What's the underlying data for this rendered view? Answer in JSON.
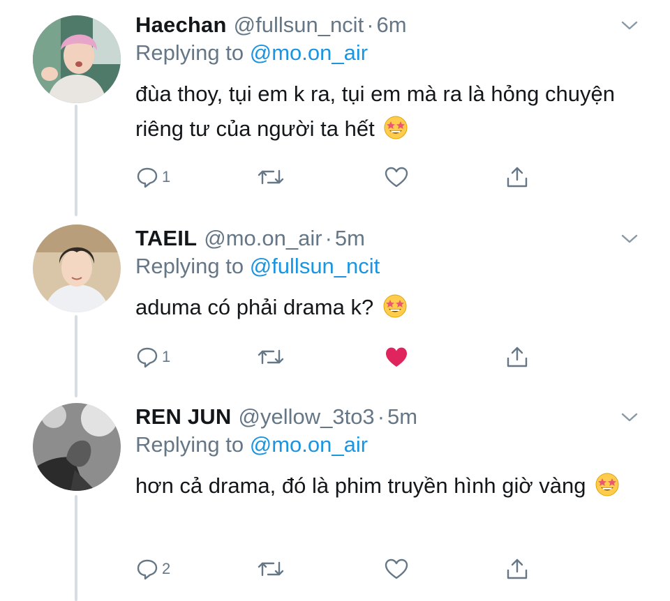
{
  "colors": {
    "text": "#14171a",
    "secondary": "#657786",
    "link": "#1b95e0",
    "like_active": "#e0245e",
    "thread_line": "#d7dde2"
  },
  "tweets": [
    {
      "name": "Haechan",
      "handle": "@fullsun_ncit",
      "separator": "·",
      "time": "6m",
      "replying_prefix": "Replying to",
      "replying_to": "@mo.on_air",
      "body": "đùa thoy, tụi em k ra, tụi em mà ra là hỏng chuyện riêng tư của người ta hết",
      "emoji": "star-struck-emoji",
      "reply_count": "1",
      "liked": false
    },
    {
      "name": "TAEIL",
      "handle": "@mo.on_air",
      "separator": "·",
      "time": "5m",
      "replying_prefix": "Replying to",
      "replying_to": "@fullsun_ncit",
      "body": "aduma có phải drama k?",
      "emoji": "star-struck-emoji",
      "reply_count": "1",
      "liked": true
    },
    {
      "name": "REN JUN",
      "handle": "@yellow_3to3",
      "separator": "·",
      "time": "5m",
      "replying_prefix": "Replying to",
      "replying_to": "@mo.on_air",
      "body": "hơn cả drama, đó là phim truyền hình giờ vàng",
      "emoji": "star-struck-emoji",
      "reply_count": "2",
      "liked": false
    }
  ]
}
